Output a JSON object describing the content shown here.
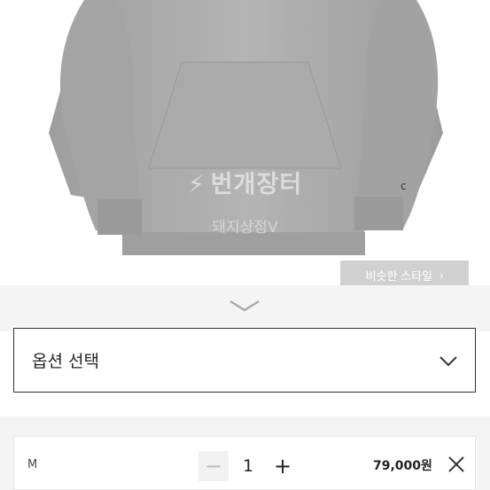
{
  "product": {
    "image_watermark_brand": "번개장터",
    "image_watermark_shop": "돼지상점V",
    "similar_style_label": "비슷한 스타일",
    "similar_style_arrow": "›"
  },
  "options": {
    "select_label": "옵션 선택"
  },
  "selected_item": {
    "size": "M",
    "quantity": "1",
    "minus_label": "−",
    "plus_label": "+",
    "price": "79,000원"
  },
  "colors": {
    "hoodie": "#a9a9a9",
    "band": "#f4f4f4",
    "border": "#333333"
  },
  "icons": {
    "expand": "chevron-down-icon",
    "select": "chevron-down-icon",
    "remove": "close-icon"
  }
}
